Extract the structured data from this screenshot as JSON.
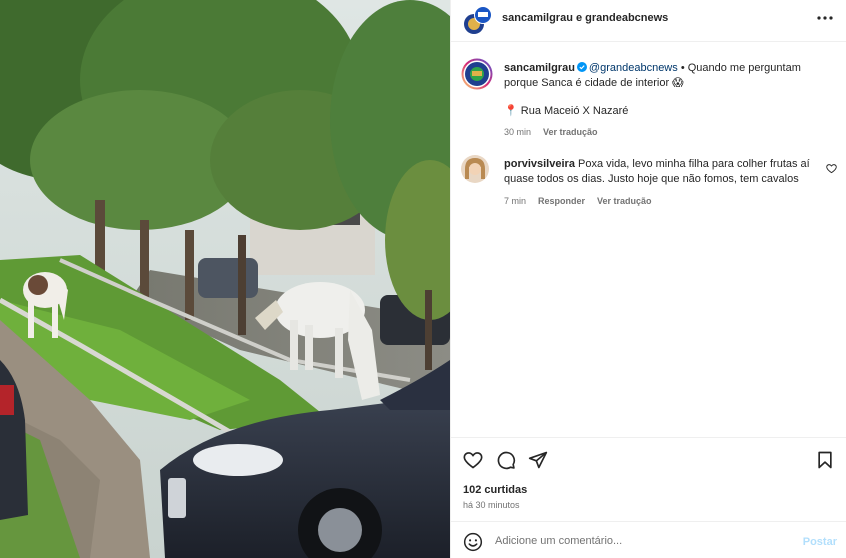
{
  "post": {
    "header_title": "sancamilgrau e grandeabcnews",
    "more_icon": "more-horizontal-icon"
  },
  "caption": {
    "username": "sancamilgrau",
    "mention": "@grandeabcnews",
    "text": " • Quando me perguntam porque Sanca é cidade de interior 😱",
    "location_pin": "📍",
    "location": "Rua Maceió X Nazaré",
    "time": "30 min",
    "translate": "Ver tradução"
  },
  "comment": {
    "username": "porvivsilveira",
    "text": " Poxa vida, levo minha filha para colher frutas aí quase todos os dias. Justo hoje que não fomos, tem cavalos",
    "time": "7 min",
    "reply": "Responder",
    "translate": "Ver tradução"
  },
  "actions": {
    "likes": "102 curtidas",
    "posted_ago": "há 30 minutos",
    "icons": [
      "heart-icon",
      "comment-icon",
      "share-icon",
      "bookmark-icon"
    ]
  },
  "compose": {
    "placeholder": "Adicione um comentário...",
    "post_label": "Postar"
  },
  "colors": {
    "link": "#00376b",
    "muted": "#737373",
    "post_disabled": "#b2dffc",
    "verified": "#0095f6"
  }
}
